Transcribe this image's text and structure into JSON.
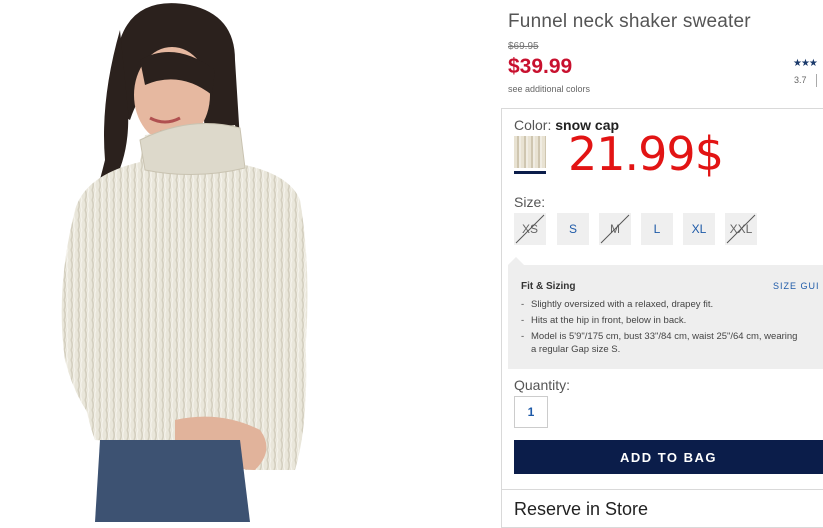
{
  "product": {
    "title": "Funnel neck shaker sweater",
    "original_price": "$69.95",
    "sale_price": "$39.99",
    "see_colors_label": "see additional colors",
    "rating_stars": "★★★",
    "rating_value": "3.7"
  },
  "color": {
    "label": "Color:",
    "selected": "snow cap"
  },
  "overlay_price": "21.99$",
  "size": {
    "label": "Size:",
    "options": [
      {
        "label": "XS",
        "available": false
      },
      {
        "label": "S",
        "available": true
      },
      {
        "label": "M",
        "available": false
      },
      {
        "label": "L",
        "available": true
      },
      {
        "label": "XL",
        "available": true
      },
      {
        "label": "XXL",
        "available": false
      }
    ]
  },
  "fit": {
    "title": "Fit & Sizing",
    "size_guide_label": "SIZE GUI",
    "items": [
      "Slightly oversized with a relaxed, drapey fit.",
      "Hits at the hip in front, below in back.",
      "Model is 5'9\"/175 cm, bust 33\"/84 cm, waist 25\"/64 cm, wearing",
      "a regular Gap size S."
    ]
  },
  "quantity": {
    "label": "Quantity:",
    "value": "1"
  },
  "add_to_bag_label": "ADD TO BAG",
  "reserve_label": "Reserve in Store",
  "colors": {
    "sale_red": "#c8102e",
    "overlay_red": "#e21414",
    "navy": "#0b1d4a",
    "link_blue": "#1e5aa8"
  }
}
